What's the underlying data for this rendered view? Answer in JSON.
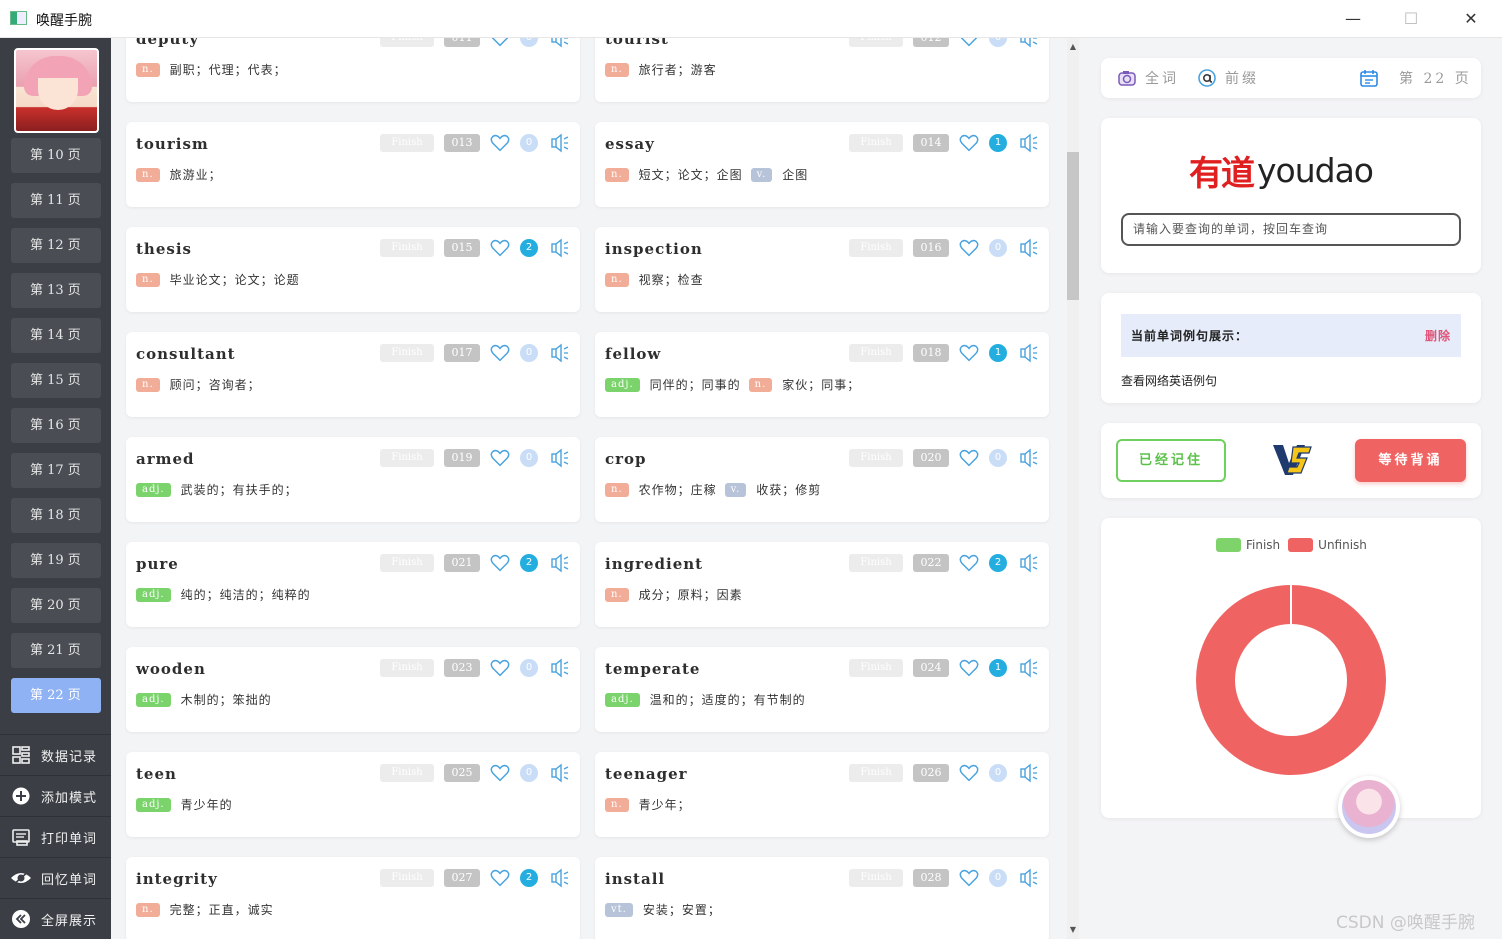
{
  "window": {
    "title": "唤醒手腕",
    "min": "—",
    "max": "☐",
    "close": "✕"
  },
  "sidebar": {
    "pages": [
      "第 10 页",
      "第 11 页",
      "第 12 页",
      "第 13 页",
      "第 14 页",
      "第 15 页",
      "第 16 页",
      "第 17 页",
      "第 18 页",
      "第 19 页",
      "第 20 页",
      "第 21 页",
      "第 22 页"
    ],
    "active_page": "第 22 页",
    "menu": [
      {
        "label": "数据记录",
        "icon": "grid-icon"
      },
      {
        "label": "添加模式",
        "icon": "plus-circle-icon"
      },
      {
        "label": "打印单词",
        "icon": "print-icon"
      },
      {
        "label": "回忆单词",
        "icon": "eye-icon"
      },
      {
        "label": "全屏展示",
        "icon": "double-chevron-left-icon"
      }
    ]
  },
  "finish_label": "Finish",
  "cards": [
    {
      "word": "deputy",
      "num": "011",
      "count": "0",
      "defs": [
        {
          "pos": "n.",
          "text": "副职；代理；代表；"
        }
      ]
    },
    {
      "word": "tourist",
      "num": "012",
      "count": "0",
      "defs": [
        {
          "pos": "n.",
          "text": "旅行者；游客"
        }
      ]
    },
    {
      "word": "tourism",
      "num": "013",
      "count": "0",
      "defs": [
        {
          "pos": "n.",
          "text": "旅游业；"
        }
      ]
    },
    {
      "word": "essay",
      "num": "014",
      "count": "1",
      "defs": [
        {
          "pos": "n.",
          "text": "短文；论文；企图"
        },
        {
          "pos": "v.",
          "text": "企图"
        }
      ]
    },
    {
      "word": "thesis",
      "num": "015",
      "count": "2",
      "defs": [
        {
          "pos": "n.",
          "text": "毕业论文；论文；论题"
        }
      ]
    },
    {
      "word": "inspection",
      "num": "016",
      "count": "0",
      "defs": [
        {
          "pos": "n.",
          "text": "视察；检查"
        }
      ]
    },
    {
      "word": "consultant",
      "num": "017",
      "count": "0",
      "defs": [
        {
          "pos": "n.",
          "text": "顾问；咨询者；"
        }
      ]
    },
    {
      "word": "fellow",
      "num": "018",
      "count": "1",
      "defs": [
        {
          "pos": "adj.",
          "text": "同伴的；同事的"
        },
        {
          "pos": "n.",
          "text": "家伙；同事；"
        }
      ]
    },
    {
      "word": "armed",
      "num": "019",
      "count": "0",
      "defs": [
        {
          "pos": "adj.",
          "text": "武装的；有扶手的；"
        }
      ]
    },
    {
      "word": "crop",
      "num": "020",
      "count": "0",
      "defs": [
        {
          "pos": "n.",
          "text": "农作物；庄稼"
        },
        {
          "pos": "v.",
          "text": "收获；修剪"
        }
      ]
    },
    {
      "word": "pure",
      "num": "021",
      "count": "2",
      "defs": [
        {
          "pos": "adj.",
          "text": "纯的；纯洁的；纯粹的"
        }
      ]
    },
    {
      "word": "ingredient",
      "num": "022",
      "count": "2",
      "defs": [
        {
          "pos": "n.",
          "text": "成分；原料；因素"
        }
      ]
    },
    {
      "word": "wooden",
      "num": "023",
      "count": "0",
      "defs": [
        {
          "pos": "adj.",
          "text": "木制的；笨拙的"
        }
      ]
    },
    {
      "word": "temperate",
      "num": "024",
      "count": "1",
      "defs": [
        {
          "pos": "adj.",
          "text": "温和的；适度的；有节制的"
        }
      ]
    },
    {
      "word": "teen",
      "num": "025",
      "count": "0",
      "defs": [
        {
          "pos": "adj.",
          "text": "青少年的"
        }
      ]
    },
    {
      "word": "teenager",
      "num": "026",
      "count": "0",
      "defs": [
        {
          "pos": "n.",
          "text": "青少年；"
        }
      ]
    },
    {
      "word": "integrity",
      "num": "027",
      "count": "2",
      "defs": [
        {
          "pos": "n.",
          "text": "完整；正直，诚实"
        }
      ]
    },
    {
      "word": "install",
      "num": "028",
      "count": "0",
      "defs": [
        {
          "pos": "vt.",
          "text": "安装；安置；"
        }
      ]
    }
  ],
  "right": {
    "tabs": {
      "all": "全词",
      "prefix": "前缀",
      "page": "第 22 页"
    },
    "youdao": {
      "cn": "有道",
      "en": "youdao",
      "placeholder": "请输入要查询的单词，按回车查询"
    },
    "example": {
      "title": "当前单词例句展示：",
      "delete": "删除",
      "link": "查看网络英语例句"
    },
    "actions": {
      "remember": "已经记住",
      "wait": "等待背诵"
    }
  },
  "chart_data": {
    "type": "pie",
    "subtype": "donut",
    "series": [
      {
        "name": "Finish",
        "value": 0,
        "color": "#7ed36b"
      },
      {
        "name": "Unfinish",
        "value": 1,
        "color": "#ef6462"
      }
    ],
    "legend": "top"
  },
  "watermark": "CSDN @唤醒手腕"
}
